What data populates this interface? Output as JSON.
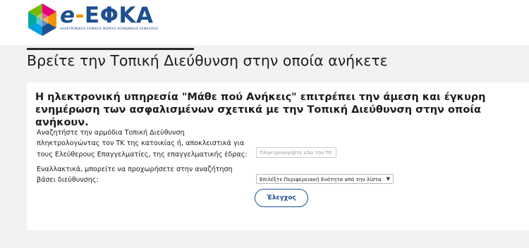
{
  "header": {
    "logo_text": "e-ΕΦΚΑ",
    "logo_prefix": "e",
    "logo_dash": "-",
    "logo_name": "ΕΦΚΑ",
    "logo_subtitle": "ΗΛΕΚΤΡΟΝΙΚΟΣ ΕΘΝΙΚΟΣ ΦΟΡΕΑΣ ΚΟΙΝΩΝΙΚΗΣ ΑΣΦΑΛΙΣΗΣ",
    "logo_colors": [
      "#e5007e",
      "#f39200",
      "#1d4f91",
      "#00a0e3",
      "#00a99d",
      "#7ab800"
    ]
  },
  "page": {
    "title": "Βρείτε την Τοπική Διεύθυνση στην οποία ανήκετε",
    "intro": "Η ηλεκτρονική υπηρεσία \"Μάθε πού Ανήκεις\" επιτρέπει την άμεση και έγκυρη ενημέρωση των ασφαλισμένων σχετικά με την Τοπική Διεύθυνση στην οποία ανήκουν."
  },
  "form": {
    "zip_label": "Αναζητήστε την αρμόδια Τοπική Διεύθυνση πληκτρολογώντας τον ΤΚ της κατοικίας ή, αποκλειστικά για τους Ελεύθερους Επαγγελματίες, της επαγγελματικής έδρας:",
    "zip_placeholder": "Πληκτρολογήστε εδώ τον ΤΚ",
    "address_label": "Εναλλακτικά, μπορείτε να προχωρήσετε στην αναζήτηση βάσει διεύθυνσης:",
    "region_selected": "Επιλέξτε Περιφερειακή Ενότητα από την λίστα",
    "check_button": "Έλεγχος"
  },
  "colors": {
    "brand_blue": "#1d4f91",
    "band_gray": "#f2f2f2"
  }
}
